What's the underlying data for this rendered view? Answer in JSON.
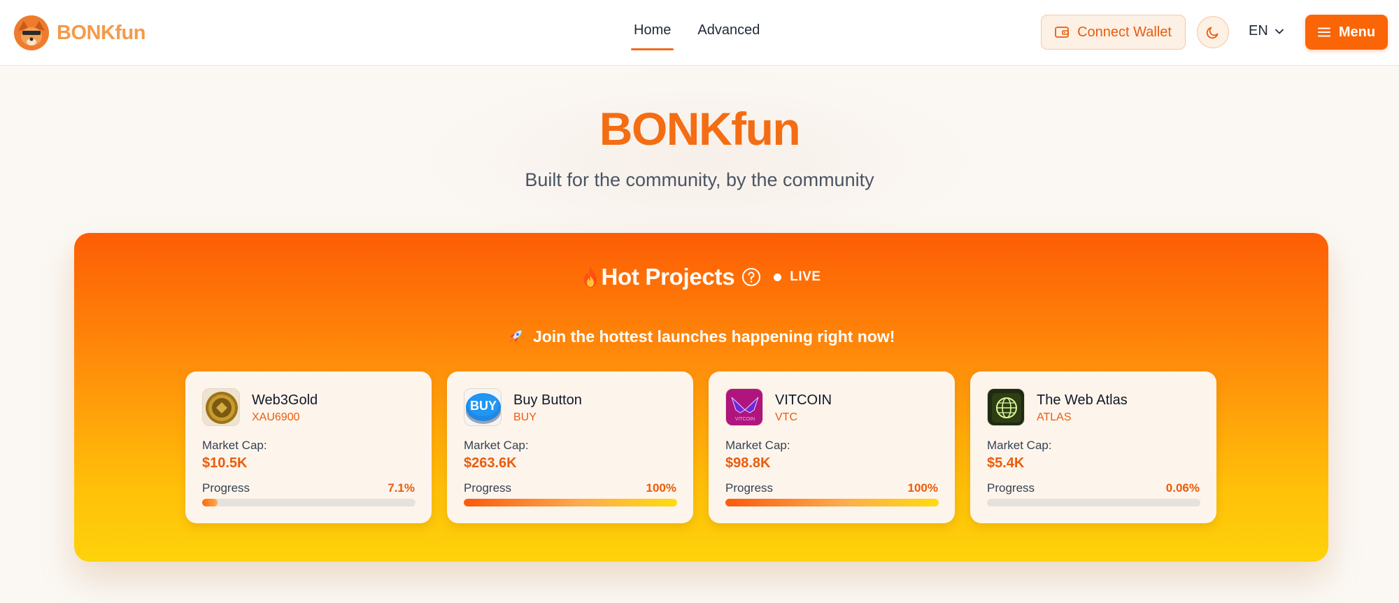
{
  "header": {
    "brand": "BONKfun",
    "nav": [
      {
        "label": "Home",
        "active": true
      },
      {
        "label": "Advanced",
        "active": false
      }
    ],
    "connect_wallet": "Connect Wallet",
    "theme_icon": "moon-icon",
    "language": "EN",
    "menu_label": "Menu"
  },
  "hero": {
    "title": "BONKfun",
    "subtitle": "Built for the community, by the community"
  },
  "hot_projects": {
    "title": "Hot Projects",
    "live_label": "LIVE",
    "subtitle": "Join the hottest launches happening right now!",
    "market_cap_label": "Market Cap:",
    "progress_label": "Progress",
    "projects": [
      {
        "name": "Web3Gold",
        "ticker": "XAU6900",
        "market_cap": "$10.5K",
        "progress_text": "7.1%",
        "progress": 0.071,
        "logo": "gold-coin-logo"
      },
      {
        "name": "Buy Button",
        "ticker": "BUY",
        "market_cap": "$263.6K",
        "progress_text": "100%",
        "progress": 1.0,
        "logo": "buy-button-logo",
        "logo_text": "BUY"
      },
      {
        "name": "VITCOIN",
        "ticker": "VTC",
        "market_cap": "$98.8K",
        "progress_text": "100%",
        "progress": 1.0,
        "logo": "vitcoin-wings-logo",
        "logo_text": "VITCOIN"
      },
      {
        "name": "The Web Atlas",
        "ticker": "ATLAS",
        "market_cap": "$5.4K",
        "progress_text": "0.06%",
        "progress": 0.0006,
        "logo": "globe-logo"
      }
    ]
  },
  "colors": {
    "accent": "#f96507",
    "brand_text": "#f59a4a",
    "panel_top": "#fd5d05",
    "panel_bottom": "#fed20a"
  }
}
